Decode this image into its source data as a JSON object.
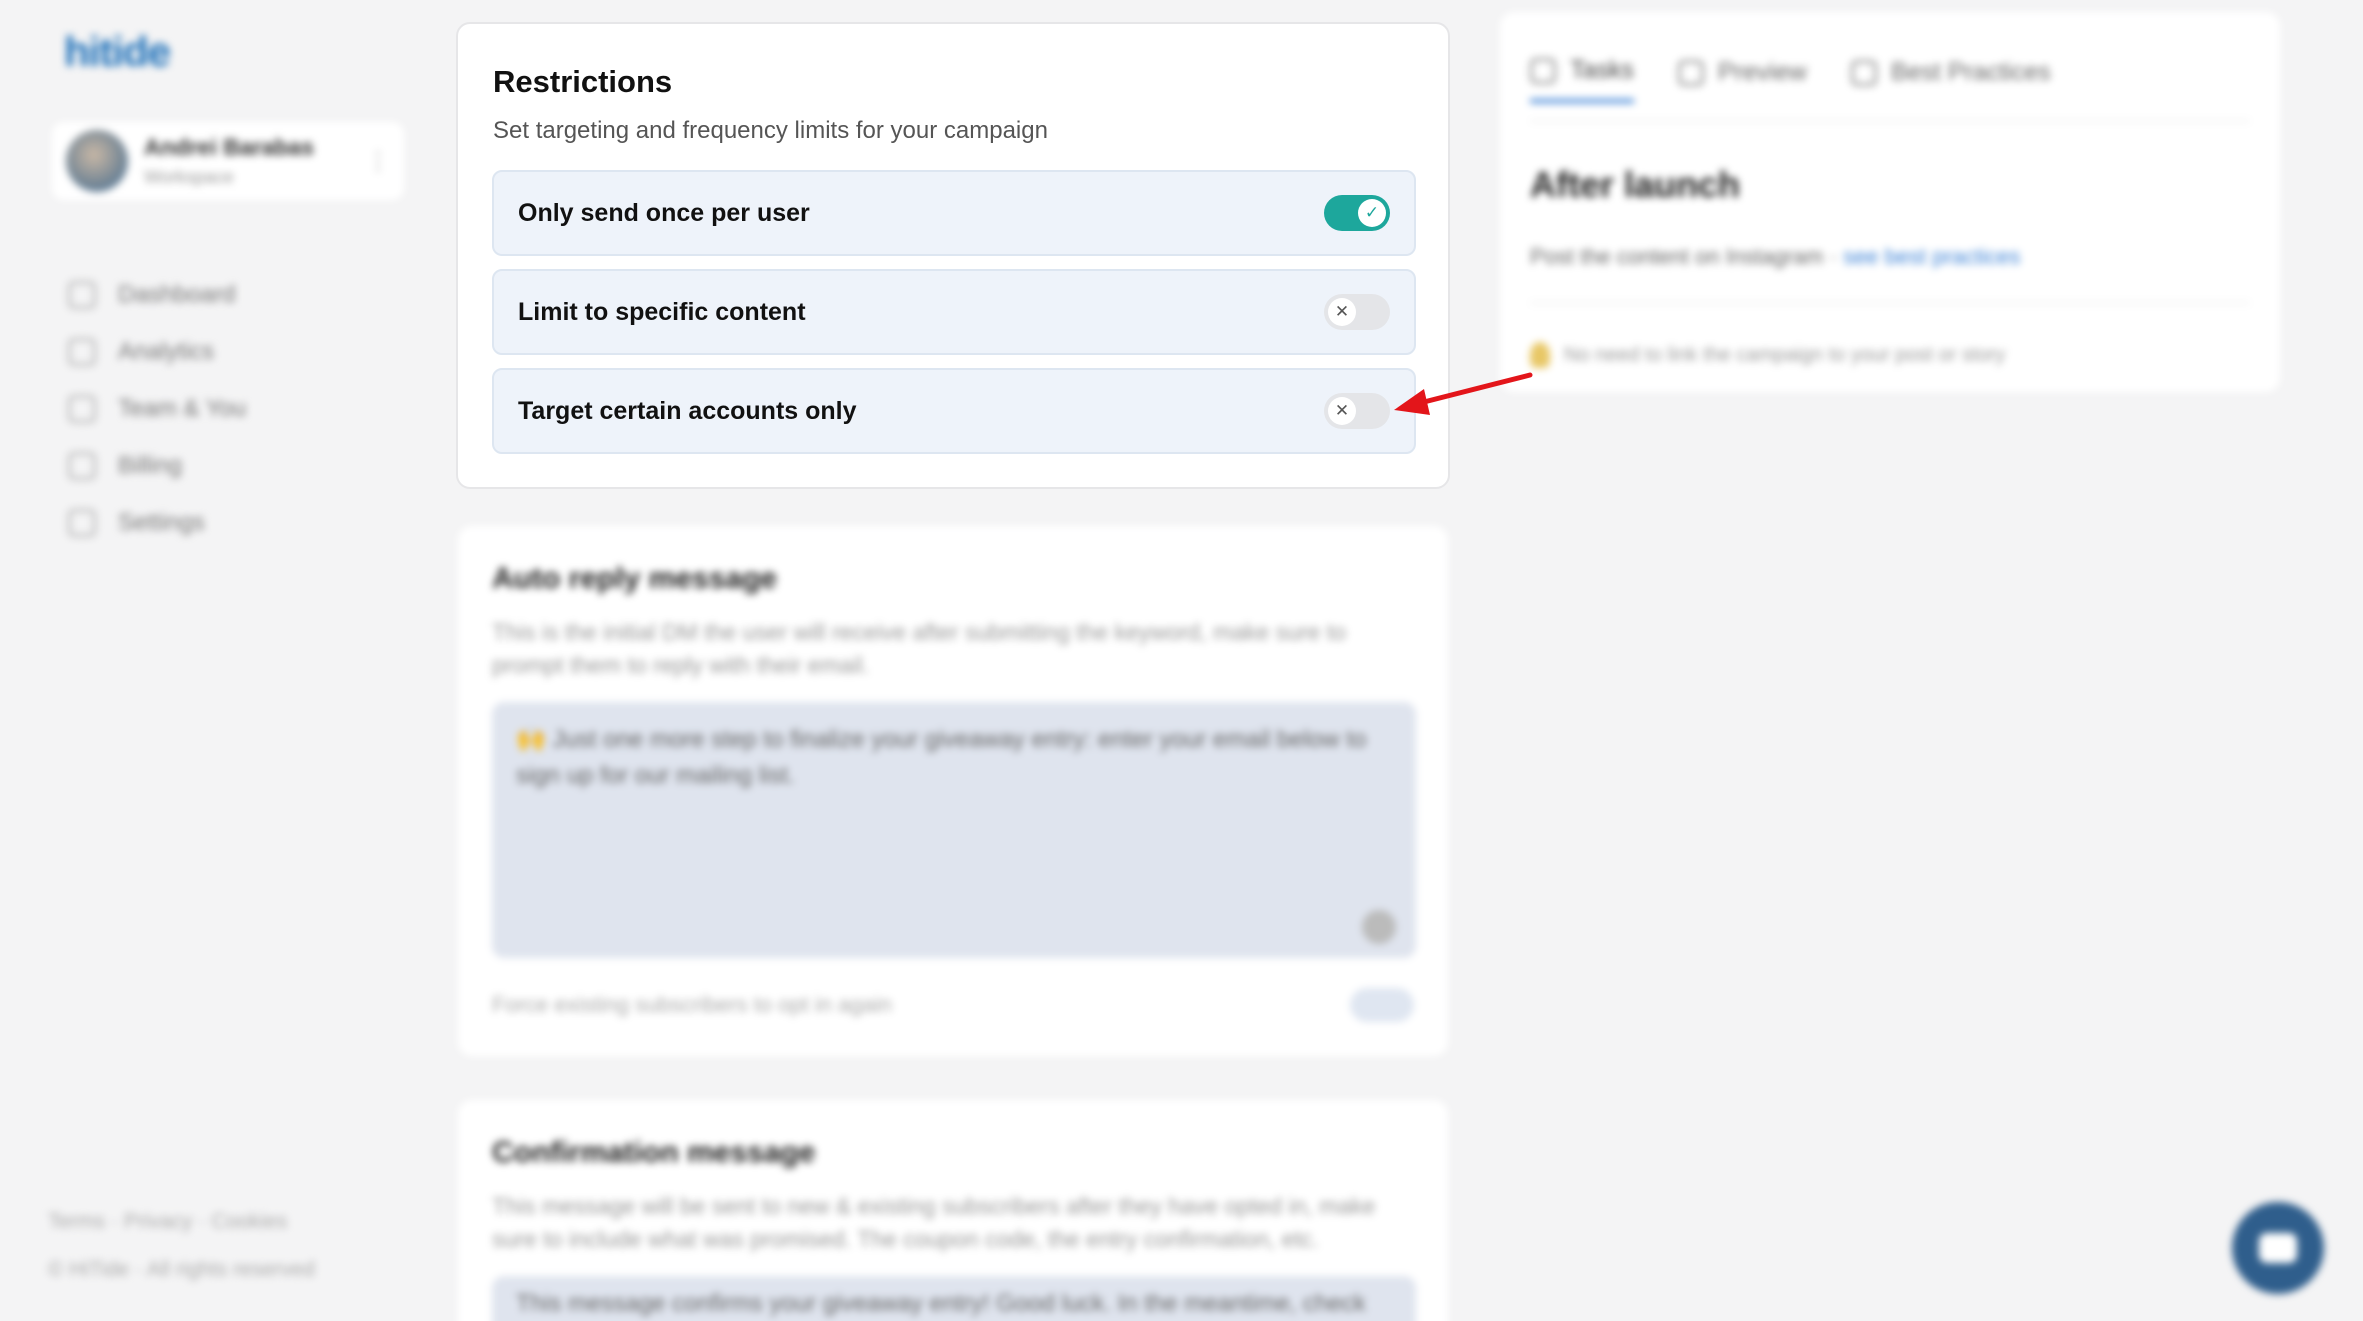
{
  "sidebar": {
    "logo": "hitide",
    "user": {
      "name": "Andrei Barabas",
      "workspace": "Workspace"
    },
    "nav": [
      {
        "label": "Dashboard",
        "icon": "dashboard-icon"
      },
      {
        "label": "Analytics",
        "icon": "analytics-icon"
      },
      {
        "label": "Team & You",
        "icon": "team-icon"
      },
      {
        "label": "Billing",
        "icon": "billing-icon"
      },
      {
        "label": "Settings",
        "icon": "settings-icon"
      }
    ],
    "footer_links": "Terms · Privacy · Cookies",
    "footer_copy": "© HiTide · All rights reserved"
  },
  "restrictions": {
    "title": "Restrictions",
    "subtitle": "Set targeting and frequency limits for your campaign",
    "rows": [
      {
        "label": "Only send once per user",
        "enabled": true
      },
      {
        "label": "Limit to specific content",
        "enabled": false
      },
      {
        "label": "Target certain accounts only",
        "enabled": false
      }
    ]
  },
  "auto_reply": {
    "title": "Auto reply message",
    "description": "This is the initial DM the user will receive after submitting the keyword, make sure to prompt them to reply with their email.",
    "message": "🙌 Just one more step to finalize your giveaway entry: enter your email below to sign up for our mailing list.",
    "footer_label": "Force existing subscribers to opt in again"
  },
  "confirmation": {
    "title": "Confirmation message",
    "description": "This message will be sent to new & existing subscribers after they have opted in, make sure to include what was promised. The coupon code, the entry confirmation, etc.",
    "message": "This message confirms your giveaway entry! Good luck. In the meantime, check"
  },
  "right_panel": {
    "tabs": [
      {
        "label": "Tasks",
        "active": true
      },
      {
        "label": "Preview",
        "active": false
      },
      {
        "label": "Best Practices",
        "active": false
      }
    ],
    "title": "After launch",
    "text": "Post the content on Instagram · ",
    "link": "see best practices",
    "tip": "No need to link the campaign to your post or story"
  },
  "colors": {
    "toggle_on": "#1da79c",
    "toggle_off": "#e4e5e8",
    "row_bg": "#eef3fa",
    "accent": "#3c82d6",
    "annotation": "#e3151a"
  }
}
